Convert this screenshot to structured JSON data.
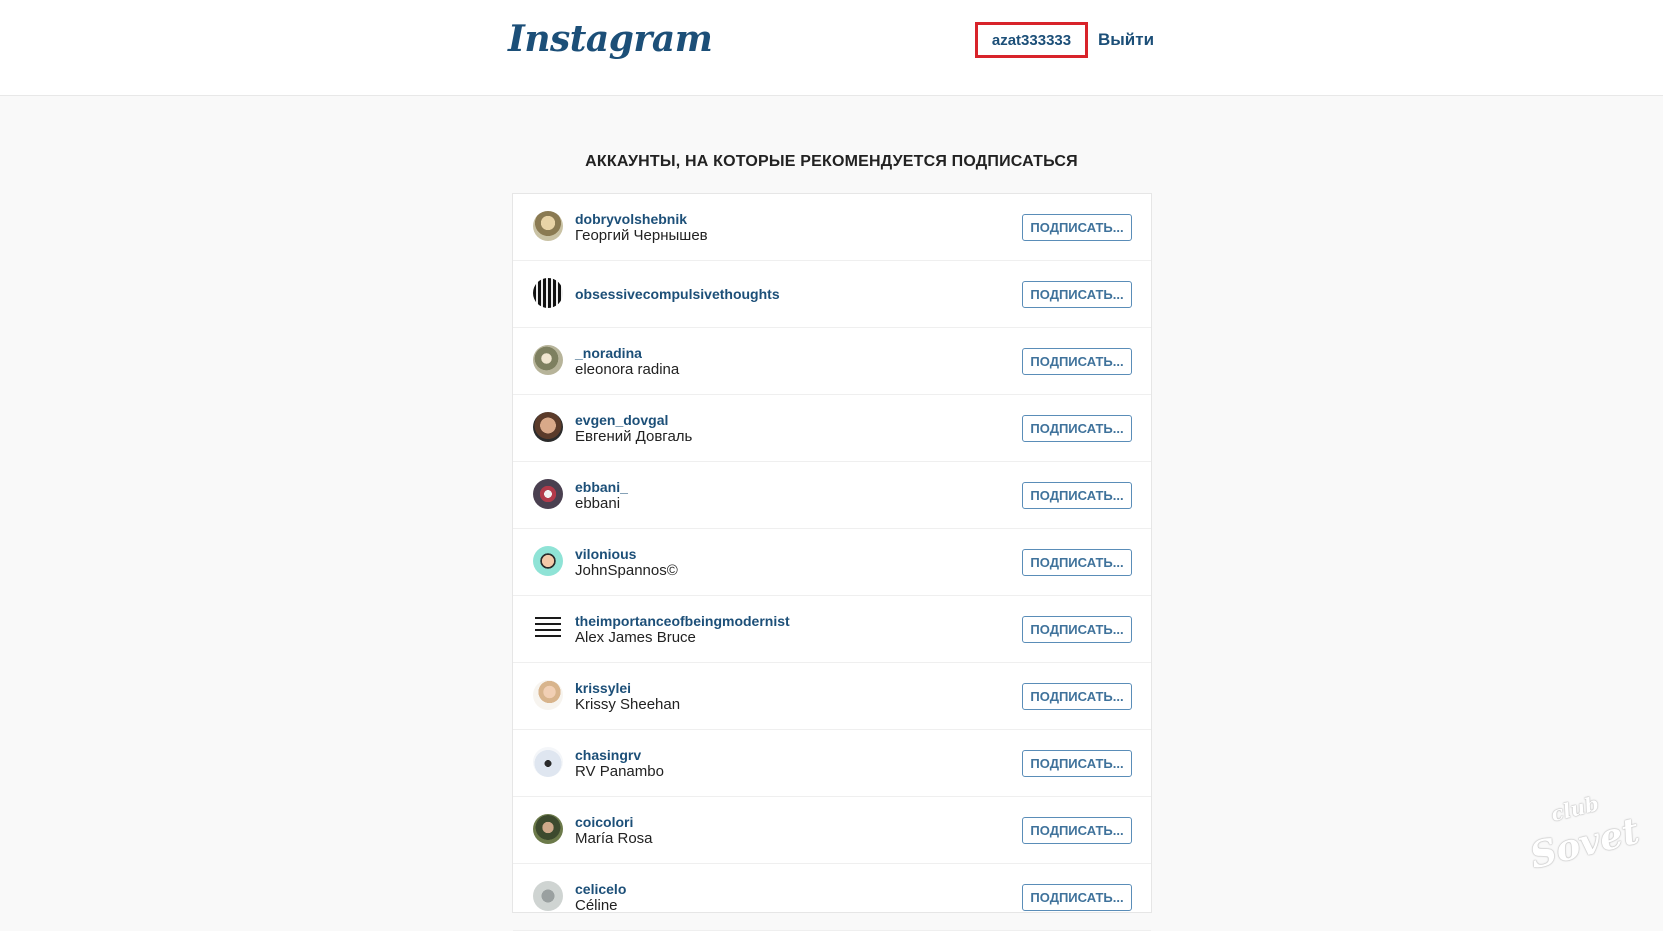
{
  "header": {
    "logo": "Instagram",
    "username": "azat333333",
    "logout": "Выйти"
  },
  "heading": "АККАУНТЫ, НА КОТОРЫЕ РЕКОМЕНДУЕТСЯ ПОДПИСАТЬСЯ",
  "accounts": [
    {
      "handle": "dobryvolshebnik",
      "name": "Георгий Чернышев",
      "follow": "ПОДПИСАТЬ..."
    },
    {
      "handle": "obsessivecompulsivethoughts",
      "name": "",
      "follow": "ПОДПИСАТЬ..."
    },
    {
      "handle": "_noradina",
      "name": "eleonora radina",
      "follow": "ПОДПИСАТЬ..."
    },
    {
      "handle": "evgen_dovgal",
      "name": "Евгений Довгаль",
      "follow": "ПОДПИСАТЬ..."
    },
    {
      "handle": "ebbani_",
      "name": "ebbani",
      "follow": "ПОДПИСАТЬ..."
    },
    {
      "handle": "vilonious",
      "name": "JohnSpannos©",
      "follow": "ПОДПИСАТЬ..."
    },
    {
      "handle": "theimportanceofbeingmodernist",
      "name": "Alex James Bruce",
      "follow": "ПОДПИСАТЬ..."
    },
    {
      "handle": "krissylei",
      "name": "Krissy Sheehan",
      "follow": "ПОДПИСАТЬ..."
    },
    {
      "handle": "chasingrv",
      "name": "RV Panambo",
      "follow": "ПОДПИСАТЬ..."
    },
    {
      "handle": "coicolori",
      "name": "María Rosa",
      "follow": "ПОДПИСАТЬ..."
    },
    {
      "handle": "celicelo",
      "name": "Céline",
      "follow": "ПОДПИСАТЬ..."
    }
  ],
  "watermark": {
    "top": "club",
    "bottom": "Sovet"
  },
  "colors": {
    "link": "#1c4f78",
    "button_border": "#5a8db8",
    "highlight": "#d8232a"
  }
}
